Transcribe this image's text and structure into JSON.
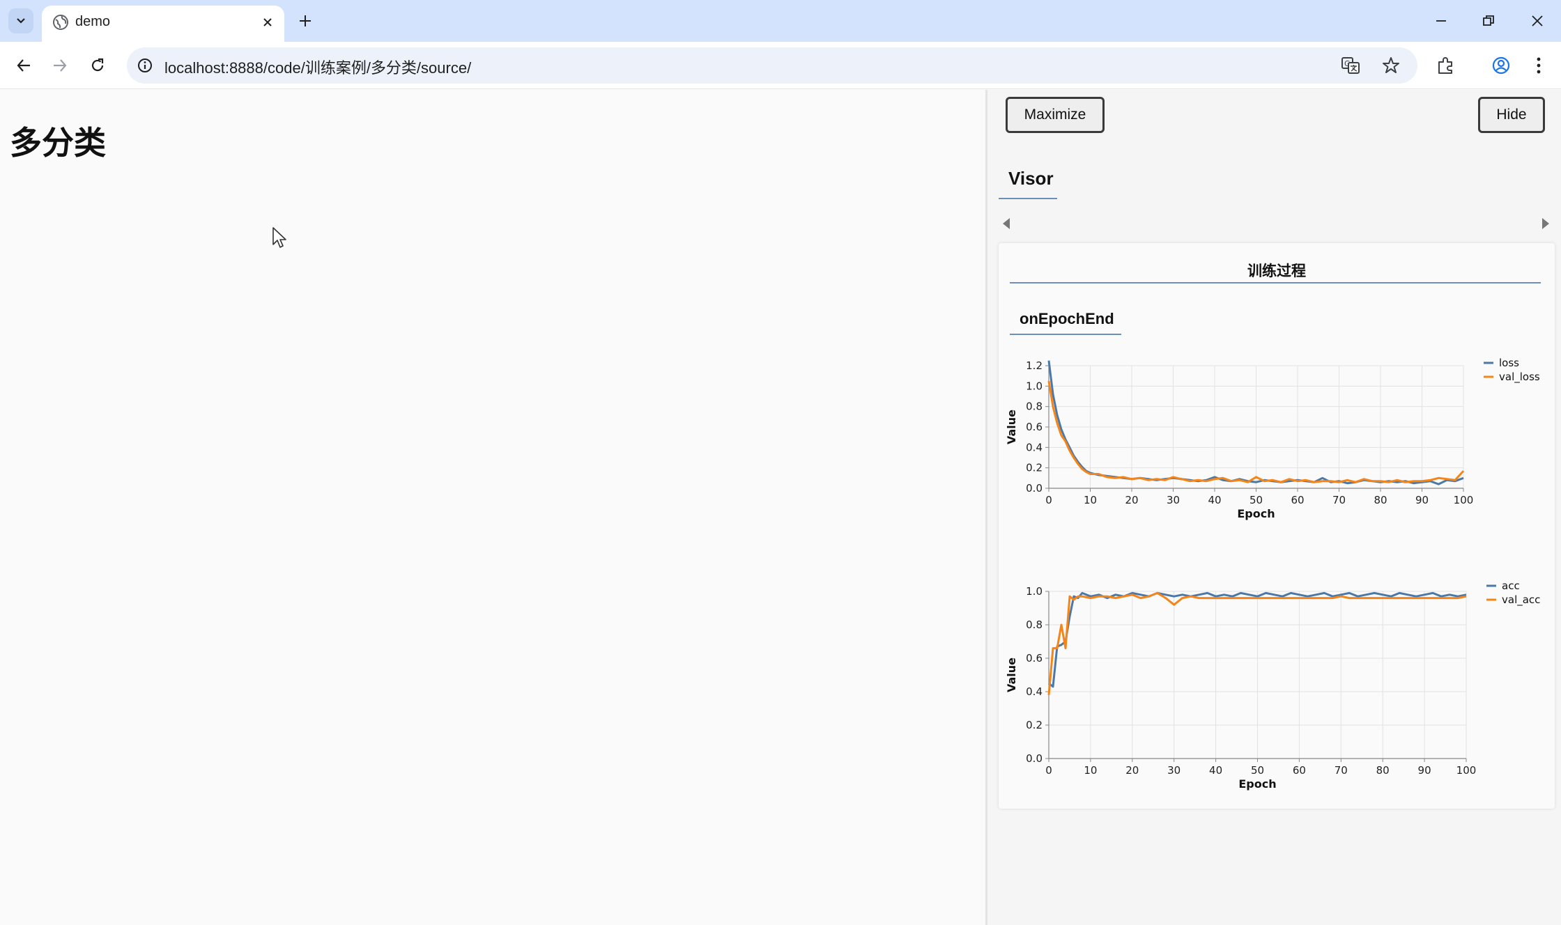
{
  "browser": {
    "tab_title": "demo",
    "url": "localhost:8888/code/训练案例/多分类/source/"
  },
  "page": {
    "heading": "多分类"
  },
  "visor": {
    "maximize_label": "Maximize",
    "hide_label": "Hide",
    "title": "Visor",
    "card_heading": "训练过程",
    "sub_heading": "onEpochEnd"
  },
  "chart_data": [
    {
      "type": "line",
      "xlabel": "Epoch",
      "ylabel": "Value",
      "xlim": [
        0,
        100
      ],
      "ylim": [
        0,
        1.2
      ],
      "x_ticks": [
        0,
        10,
        20,
        30,
        40,
        50,
        60,
        70,
        80,
        90,
        100
      ],
      "y_ticks": [
        0.0,
        0.2,
        0.4,
        0.6,
        0.8,
        1.0,
        1.2
      ],
      "y_tick_labels": [
        "0.0",
        "0.2",
        "0.4",
        "0.6",
        "0.8",
        "1.0",
        "1.2"
      ],
      "grid": true,
      "legend": "right",
      "series": [
        {
          "name": "loss",
          "color": "#4c78a8",
          "x": [
            0,
            1,
            2,
            3,
            4,
            5,
            6,
            7,
            8,
            9,
            10,
            12,
            14,
            16,
            18,
            20,
            22,
            24,
            26,
            28,
            30,
            32,
            34,
            36,
            38,
            40,
            42,
            44,
            46,
            48,
            50,
            52,
            54,
            56,
            58,
            60,
            62,
            64,
            66,
            68,
            70,
            72,
            74,
            76,
            78,
            80,
            82,
            84,
            86,
            88,
            90,
            92,
            94,
            96,
            98,
            100
          ],
          "values": [
            1.25,
            0.92,
            0.72,
            0.58,
            0.48,
            0.4,
            0.32,
            0.26,
            0.21,
            0.17,
            0.15,
            0.13,
            0.12,
            0.11,
            0.1,
            0.09,
            0.1,
            0.09,
            0.08,
            0.09,
            0.1,
            0.09,
            0.08,
            0.07,
            0.08,
            0.11,
            0.08,
            0.07,
            0.09,
            0.07,
            0.06,
            0.08,
            0.07,
            0.06,
            0.07,
            0.08,
            0.07,
            0.06,
            0.1,
            0.06,
            0.07,
            0.05,
            0.06,
            0.08,
            0.07,
            0.06,
            0.07,
            0.06,
            0.07,
            0.05,
            0.06,
            0.07,
            0.04,
            0.08,
            0.07,
            0.1
          ]
        },
        {
          "name": "val_loss",
          "color": "#f58518",
          "x": [
            0,
            1,
            2,
            3,
            4,
            5,
            6,
            7,
            8,
            9,
            10,
            12,
            14,
            16,
            18,
            20,
            22,
            24,
            26,
            28,
            30,
            32,
            34,
            36,
            38,
            40,
            42,
            44,
            46,
            48,
            50,
            52,
            54,
            56,
            58,
            60,
            62,
            64,
            66,
            68,
            70,
            72,
            74,
            76,
            78,
            80,
            82,
            84,
            86,
            88,
            90,
            92,
            94,
            96,
            98,
            100
          ],
          "values": [
            1.05,
            0.8,
            0.64,
            0.52,
            0.46,
            0.37,
            0.3,
            0.24,
            0.19,
            0.16,
            0.14,
            0.14,
            0.11,
            0.1,
            0.11,
            0.09,
            0.1,
            0.08,
            0.09,
            0.08,
            0.11,
            0.09,
            0.07,
            0.08,
            0.07,
            0.09,
            0.1,
            0.07,
            0.08,
            0.06,
            0.11,
            0.07,
            0.08,
            0.06,
            0.09,
            0.07,
            0.08,
            0.06,
            0.07,
            0.07,
            0.06,
            0.08,
            0.06,
            0.09,
            0.07,
            0.07,
            0.06,
            0.08,
            0.06,
            0.07,
            0.07,
            0.08,
            0.1,
            0.09,
            0.08,
            0.17
          ]
        }
      ]
    },
    {
      "type": "line",
      "xlabel": "Epoch",
      "ylabel": "Value",
      "xlim": [
        0,
        100
      ],
      "ylim": [
        0,
        1.0
      ],
      "x_ticks": [
        0,
        10,
        20,
        30,
        40,
        50,
        60,
        70,
        80,
        90,
        100
      ],
      "y_ticks": [
        0.0,
        0.2,
        0.4,
        0.6,
        0.8,
        1.0
      ],
      "y_tick_labels": [
        "0.0",
        "0.2",
        "0.4",
        "0.6",
        "0.8",
        "1.0"
      ],
      "grid": true,
      "legend": "right",
      "series": [
        {
          "name": "acc",
          "color": "#4c78a8",
          "x": [
            0,
            1,
            2,
            3,
            4,
            5,
            6,
            7,
            8,
            10,
            12,
            14,
            16,
            18,
            20,
            22,
            24,
            26,
            28,
            30,
            32,
            34,
            36,
            38,
            40,
            42,
            44,
            46,
            48,
            50,
            52,
            54,
            56,
            58,
            60,
            62,
            64,
            66,
            68,
            70,
            72,
            74,
            76,
            78,
            80,
            82,
            84,
            86,
            88,
            90,
            92,
            94,
            96,
            98,
            100
          ],
          "values": [
            0.45,
            0.43,
            0.67,
            0.68,
            0.7,
            0.85,
            0.97,
            0.96,
            0.99,
            0.97,
            0.98,
            0.96,
            0.98,
            0.97,
            0.99,
            0.98,
            0.97,
            0.99,
            0.98,
            0.97,
            0.98,
            0.97,
            0.98,
            0.99,
            0.97,
            0.98,
            0.97,
            0.99,
            0.98,
            0.97,
            0.99,
            0.98,
            0.97,
            0.99,
            0.98,
            0.97,
            0.98,
            0.99,
            0.97,
            0.98,
            0.99,
            0.97,
            0.98,
            0.99,
            0.98,
            0.97,
            0.99,
            0.98,
            0.97,
            0.98,
            0.99,
            0.97,
            0.98,
            0.97,
            0.98
          ]
        },
        {
          "name": "val_acc",
          "color": "#f58518",
          "x": [
            0,
            1,
            2,
            3,
            4,
            5,
            6,
            7,
            8,
            10,
            12,
            14,
            16,
            18,
            20,
            22,
            24,
            26,
            28,
            30,
            32,
            34,
            36,
            38,
            40,
            42,
            44,
            46,
            48,
            50,
            52,
            54,
            56,
            58,
            60,
            62,
            64,
            66,
            68,
            70,
            72,
            74,
            76,
            78,
            80,
            82,
            84,
            86,
            88,
            90,
            92,
            94,
            96,
            98,
            100
          ],
          "values": [
            0.38,
            0.66,
            0.66,
            0.8,
            0.66,
            0.97,
            0.95,
            0.97,
            0.97,
            0.96,
            0.97,
            0.97,
            0.96,
            0.97,
            0.98,
            0.96,
            0.97,
            0.99,
            0.96,
            0.92,
            0.96,
            0.97,
            0.96,
            0.96,
            0.96,
            0.96,
            0.96,
            0.96,
            0.96,
            0.96,
            0.96,
            0.96,
            0.96,
            0.96,
            0.96,
            0.96,
            0.96,
            0.96,
            0.96,
            0.97,
            0.96,
            0.96,
            0.96,
            0.96,
            0.96,
            0.96,
            0.96,
            0.96,
            0.96,
            0.96,
            0.96,
            0.96,
            0.96,
            0.96,
            0.97
          ]
        }
      ]
    }
  ]
}
